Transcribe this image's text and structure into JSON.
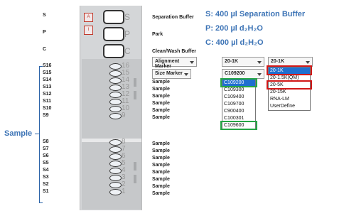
{
  "top_labels": [
    "S",
    "P",
    "C"
  ],
  "buttons": [
    "A",
    "I"
  ],
  "vial_letters": [
    "S",
    "P",
    "C"
  ],
  "top_descriptions": [
    "Separation Buffer",
    "Park",
    "Clean/Wash Buffer"
  ],
  "info_lines": [
    "S: 400 µl Separation Buffer",
    "P: 200 µl d₂H₂O",
    "C: 400 µl d₂H₂O"
  ],
  "rows": [
    {
      "label": "S16",
      "num": "16",
      "desc": ""
    },
    {
      "label": "S15",
      "num": "15",
      "desc": ""
    },
    {
      "label": "S14",
      "num": "14",
      "desc": "Sample"
    },
    {
      "label": "S13",
      "num": "13",
      "desc": "Sample"
    },
    {
      "label": "S12",
      "num": "12",
      "desc": "Sample"
    },
    {
      "label": "S11",
      "num": "11",
      "desc": "Sample"
    },
    {
      "label": "S10",
      "num": "10",
      "desc": "Sample"
    },
    {
      "label": "S9",
      "num": "9",
      "desc": "Sample"
    },
    {
      "label": "S8",
      "num": "8",
      "desc": "Sample"
    },
    {
      "label": "S7",
      "num": "7",
      "desc": "Sample"
    },
    {
      "label": "S6",
      "num": "6",
      "desc": "Sample"
    },
    {
      "label": "S5",
      "num": "5",
      "desc": "Sample"
    },
    {
      "label": "S4",
      "num": "4",
      "desc": "Sample"
    },
    {
      "label": "S3",
      "num": "3",
      "desc": "Sample"
    },
    {
      "label": "S2",
      "num": "2",
      "desc": "Sample"
    },
    {
      "label": "S1",
      "num": "1",
      "desc": "Sample"
    }
  ],
  "dropdowns": {
    "alignment_marker": "Alignment Marker",
    "size_marker": "Size Marker",
    "method_a": "20-1K",
    "method_b": "20-1K",
    "cartridge": "C109200"
  },
  "cartridge_list": [
    "C109200",
    "C109300",
    "C109400",
    "C109700",
    "C900400",
    "C100301",
    "C109600"
  ],
  "method_list": [
    "20-1K",
    "20-1.5K(QM)",
    "20-5K",
    "20-15K",
    "RNA-LM",
    "UserDefine"
  ],
  "side_label": "Sample",
  "colors": {
    "info_blue": "#3d74b6",
    "highlight_green": "#26a545",
    "highlight_red": "#d11818",
    "selection_blue": "#1e6fd0"
  }
}
